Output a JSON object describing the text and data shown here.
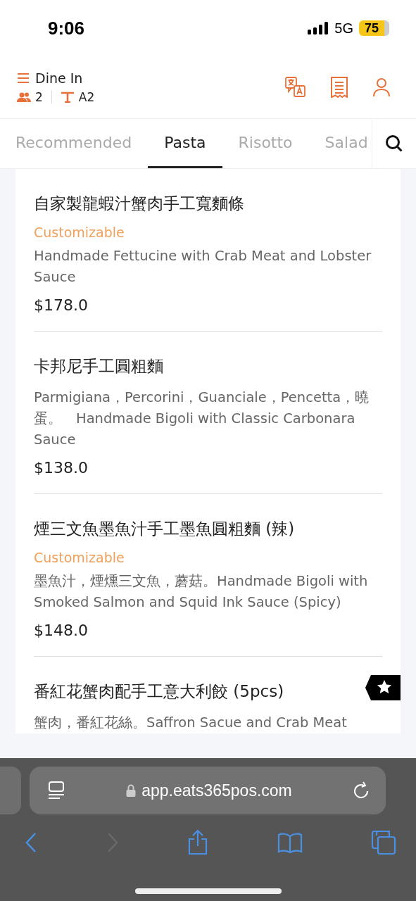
{
  "status_bar": {
    "time": "9:06",
    "network": "5G",
    "battery": "75"
  },
  "header": {
    "mode": "Dine In",
    "guests": "2",
    "table": "A2"
  },
  "tabs": [
    {
      "label": "Recommended",
      "selected": false
    },
    {
      "label": "Pasta",
      "selected": true
    },
    {
      "label": "Risotto",
      "selected": false
    },
    {
      "label": "Salad",
      "selected": false
    }
  ],
  "items": [
    {
      "name": "自家製龍蝦汁蟹肉手工寬麵條",
      "tag": "Customizable",
      "description": "Handmade Fettucine with Crab Meat and Lobster Sauce",
      "price": "$178.0",
      "starred": false
    },
    {
      "name": "卡邦尼手工圓粗麵",
      "description": "Parmigiana，Percorini，Guanciale，Pencetta，曉蛋。　Handmade Bigoli with Classic Carbonara Sauce",
      "price": "$138.0",
      "starred": false
    },
    {
      "name": "煙三文魚墨魚汁手工墨魚圓粗麵 (辣)",
      "tag": "Customizable",
      "description": "墨魚汁，煙燻三文魚，蘑菇。Handmade Bigoli with Smoked Salmon and Squid Ink Sauce (Spicy)",
      "price": "$148.0",
      "starred": false
    },
    {
      "name": "番紅花蟹肉配手工意大利餃 (5pcs)",
      "description": "蟹肉，番紅花絲。Saffron Sacue and Crab Meat",
      "starred": true
    }
  ],
  "browser": {
    "url": "app.eats365pos.com"
  }
}
